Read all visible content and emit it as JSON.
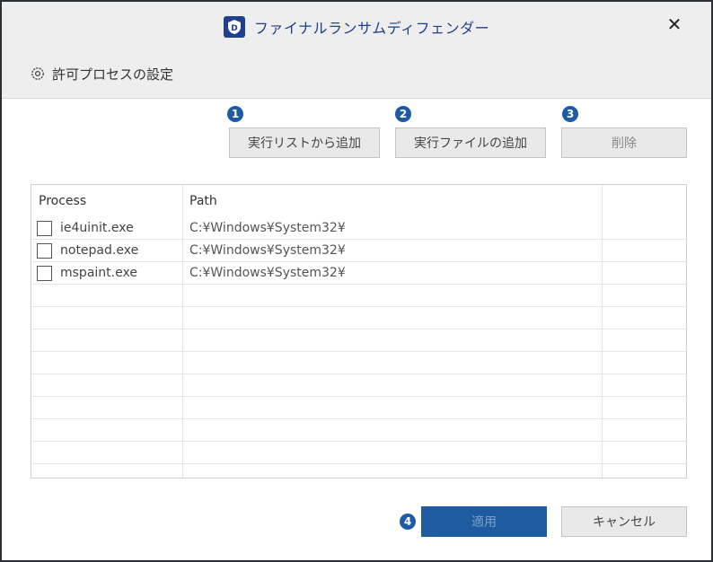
{
  "window": {
    "title": "ファイナルランサムディフェンダー",
    "close_label": "✕",
    "logo_letter": "D"
  },
  "subtitle": {
    "icon": "gear-icon",
    "label": "許可プロセスの設定"
  },
  "toolbar": {
    "badges": [
      "1",
      "2",
      "3",
      "4"
    ],
    "add_from_list_label": "実行リストから追加",
    "add_file_label": "実行ファイルの追加",
    "delete_label": "削除"
  },
  "table": {
    "headers": [
      "Process",
      "Path"
    ],
    "rows": [
      {
        "process": "ie4uinit.exe",
        "path": "C:¥Windows¥System32¥"
      },
      {
        "process": "notepad.exe",
        "path": "C:¥Windows¥System32¥"
      },
      {
        "process": "mspaint.exe",
        "path": "C:¥Windows¥System32¥"
      }
    ]
  },
  "footer": {
    "apply_label": "適用",
    "cancel_label": "キャンセル"
  },
  "colors": {
    "accent": "#1f3f8f",
    "badge": "#1f5aa6",
    "apply_button": "#1e5ba0"
  }
}
